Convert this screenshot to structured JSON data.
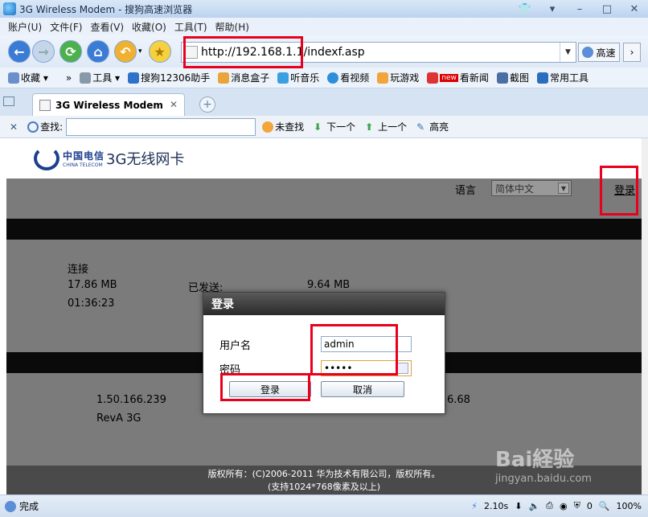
{
  "window": {
    "title": "3G Wireless Modem - 搜狗高速浏览器"
  },
  "menu": {
    "items": [
      "账户(U)",
      "文件(F)",
      "查看(V)",
      "收藏(O)",
      "工具(T)",
      "帮助(H)"
    ]
  },
  "address_bar": {
    "url": "http://192.168.1.1/indexf.asp",
    "speed_label": "高速"
  },
  "favorites_bar": {
    "items": [
      "收藏",
      "工具",
      "搜狗12306助手",
      "消息盒子",
      "听音乐",
      "看视频",
      "玩游戏",
      "看新闻",
      "截图",
      "常用工具"
    ],
    "new_badge": "new"
  },
  "tabs": [
    {
      "label": "3G Wireless Modem",
      "active": true
    }
  ],
  "find_bar": {
    "label": "查找:",
    "value": "",
    "buttons": [
      "未查找",
      "下一个",
      "上一个",
      "高亮"
    ]
  },
  "page": {
    "brand_cn": "中国电信",
    "brand_en": "CHINA TELECOM",
    "product_name": "3G无线网卡",
    "language_label": "语言",
    "language_selected": "简体中文",
    "login_link": "登录",
    "connection_status": "连接",
    "received": "17.86 MB",
    "sent_label": "已发送:",
    "sent": "9.64 MB",
    "duration": "01:36:23",
    "ip_address": "1.50.166.239",
    "right_value": "6.68",
    "hardware_version": "RevA 3G",
    "footer_line1": "版权所有：(C)2006-2011 华为技术有限公司，版权所有。",
    "footer_line2": "(支持1024*768像素及以上)"
  },
  "login_dialog": {
    "title": "登录",
    "username_label": "用户名",
    "username_value": "admin",
    "password_label": "密码",
    "password_value": "•••••",
    "login_button": "登录",
    "cancel_button": "取消"
  },
  "status_bar": {
    "status": "完成",
    "load_time": "2.10s",
    "counter": "0",
    "zoom": "100%"
  },
  "watermark": {
    "brand": "Bai経验",
    "url": "jingyan.baidu.com"
  },
  "colors": {
    "highlight": "#e8001c",
    "overlay": "#7b7b7b",
    "brand_blue": "#1c3f8f"
  }
}
